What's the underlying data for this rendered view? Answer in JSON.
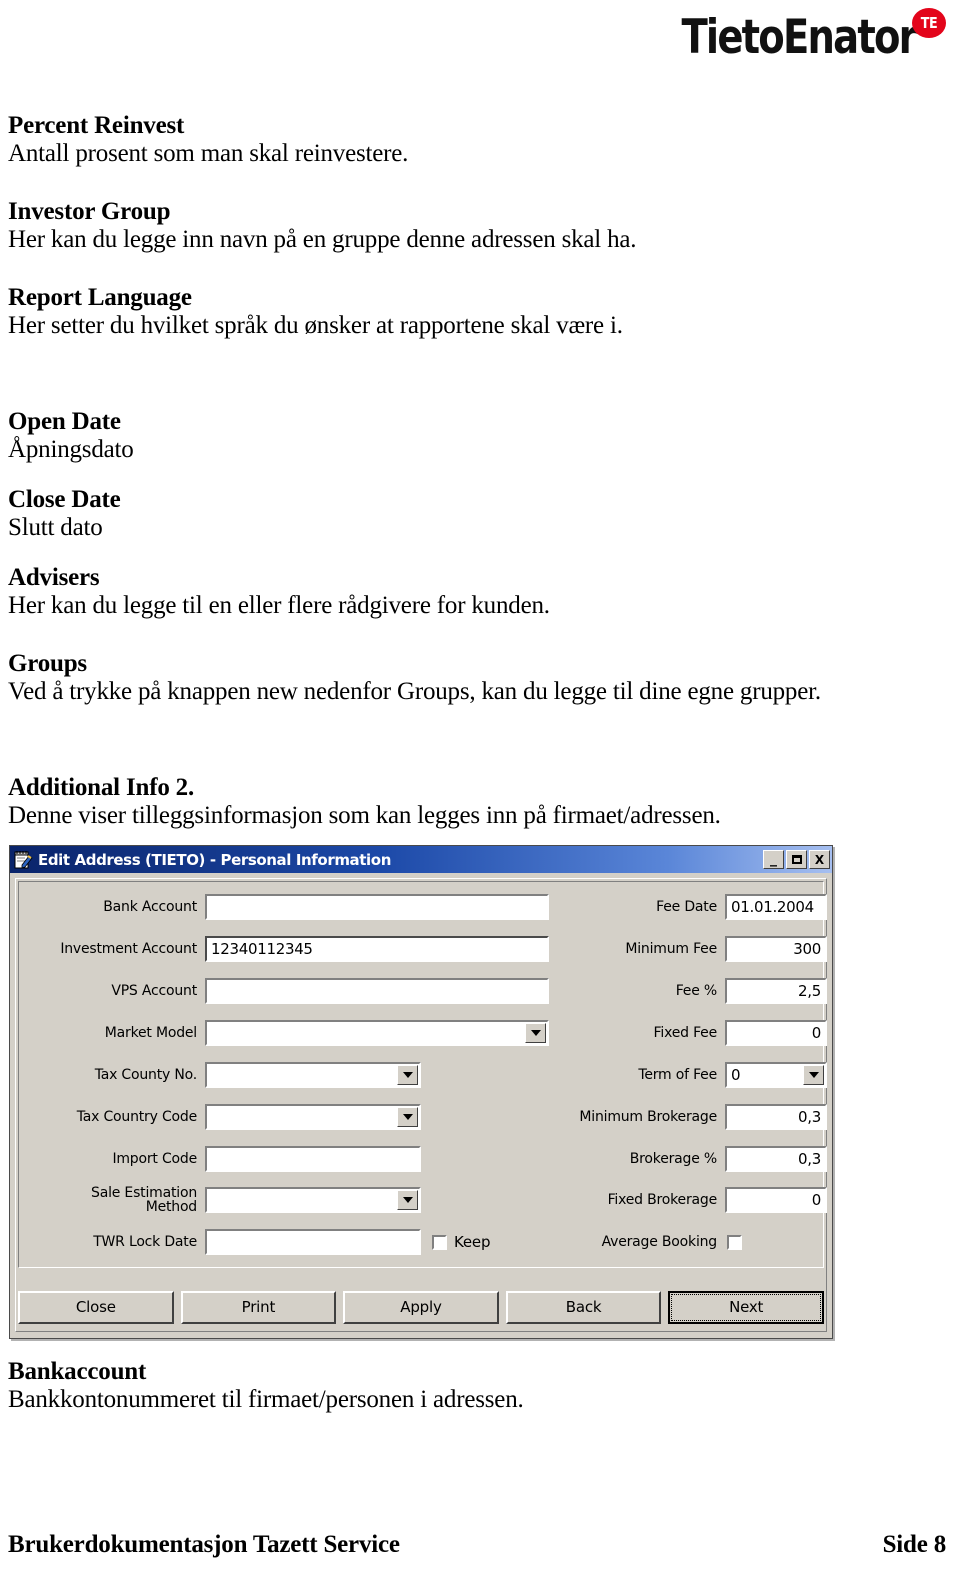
{
  "logo": {
    "wordmark": "TietoEnator",
    "badge": "TE",
    "brand_red": "#e3051b"
  },
  "document": {
    "sections": [
      {
        "term": "Percent Reinvest",
        "desc": "Antall prosent som man skal reinvestere."
      },
      {
        "term": "Investor Group",
        "desc": "Her kan du legge inn navn på en gruppe denne adressen skal ha."
      },
      {
        "term": "Report Language",
        "desc": "Her setter du hvilket språk du ønsker at rapportene skal være i."
      },
      {
        "term": "Open Date",
        "desc": "Åpningsdato"
      },
      {
        "term": "Close Date",
        "desc": "Slutt dato"
      },
      {
        "term": "Advisers",
        "desc": "Her kan du legge til en eller flere rådgivere for kunden."
      },
      {
        "term": "Groups",
        "desc": "Ved å trykke på knappen new nedenfor Groups, kan du legge til dine egne grupper."
      },
      {
        "term": "Additional Info 2.",
        "desc": "Denne viser tilleggsinformasjon som kan legges inn på firmaet/adressen."
      },
      {
        "term": "Bankaccount",
        "desc": "Bankkontonummeret til firmaet/personen i adressen."
      }
    ]
  },
  "dialog": {
    "title": "Edit Address (TIETO) - Personal Information",
    "title_gradient_from": "#0a246a",
    "title_gradient_to": "#a6bff0",
    "face_color": "#d4d0c8",
    "window_controls": {
      "minimize": "_",
      "maximize": "",
      "close": "X"
    },
    "left_fields": [
      {
        "label": "Bank Account",
        "value": "",
        "type": "text",
        "focused": false
      },
      {
        "label": "Investment Account",
        "value": "12340112345",
        "type": "text",
        "focused": true
      },
      {
        "label": "VPS Account",
        "value": "",
        "type": "text",
        "focused": false
      },
      {
        "label": "Market Model",
        "value": "",
        "type": "combo",
        "focused": false
      },
      {
        "label": "Tax County No.",
        "value": "",
        "type": "combo",
        "focused": false
      },
      {
        "label": "Tax Country Code",
        "value": "",
        "type": "combo",
        "focused": false
      },
      {
        "label": "Import Code",
        "value": "",
        "type": "text",
        "focused": false
      },
      {
        "label": "Sale Estimation\nMethod",
        "value": "",
        "type": "combo",
        "focused": false
      },
      {
        "label": "TWR Lock Date",
        "value": "",
        "type": "text",
        "focused": false
      }
    ],
    "keep_checkbox": {
      "label": "Keep",
      "checked": false
    },
    "right_fields": [
      {
        "label": "Fee Date",
        "value": "01.01.2004",
        "type": "text",
        "align": "left"
      },
      {
        "label": "Minimum Fee",
        "value": "300",
        "type": "text",
        "align": "right"
      },
      {
        "label": "Fee %",
        "value": "2,5",
        "type": "text",
        "align": "right"
      },
      {
        "label": "Fixed Fee",
        "value": "0",
        "type": "text",
        "align": "right"
      },
      {
        "label": "Term of Fee",
        "value": "0",
        "type": "combo",
        "align": "left"
      },
      {
        "label": "Minimum Brokerage",
        "value": "0,3",
        "type": "text",
        "align": "right"
      },
      {
        "label": "Brokerage %",
        "value": "0,3",
        "type": "text",
        "align": "right"
      },
      {
        "label": "Fixed Brokerage",
        "value": "0",
        "type": "text",
        "align": "right"
      }
    ],
    "average_booking_checkbox": {
      "label": "Average Booking",
      "checked": false
    },
    "buttons": [
      {
        "label": "Close",
        "default": false
      },
      {
        "label": "Print",
        "default": false
      },
      {
        "label": "Apply",
        "default": false
      },
      {
        "label": "Back",
        "default": false
      },
      {
        "label": "Next",
        "default": true
      }
    ]
  },
  "footer": {
    "left": "Brukerdokumentasjon Tazett Service",
    "right": "Side 8"
  }
}
